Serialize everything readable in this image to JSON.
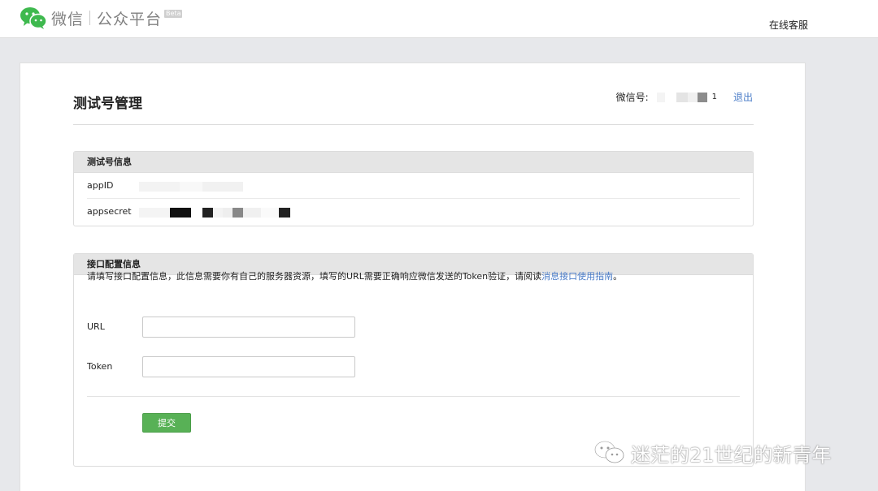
{
  "header": {
    "brand": "微信",
    "platform": "公众平台",
    "beta_badge": "Beta",
    "support_link": "在线客服"
  },
  "page": {
    "title": "测试号管理",
    "account_label": "微信号:",
    "account_tail": "1",
    "logout": "退出"
  },
  "test_account_panel": {
    "heading": "测试号信息",
    "rows": [
      {
        "label": "appID"
      },
      {
        "label": "appsecret"
      }
    ]
  },
  "interface_panel": {
    "heading": "接口配置信息",
    "intro_text": "请填写接口配置信息，此信息需要你有自己的服务器资源，填写的URL需要正确响应微信发送的Token验证，请阅读",
    "intro_link": "消息接口使用指南",
    "intro_end": "。",
    "url_label": "URL",
    "url_value": "",
    "token_label": "Token",
    "token_value": "",
    "submit_label": "提交"
  },
  "watermark": {
    "text": "迷茫的21世纪的新青年"
  },
  "colors": {
    "background": "#e7e8eb",
    "link": "#4a7cc8",
    "submit_button": "#58b156",
    "panel_header": "#e5e5e5",
    "brand_green": "#3eb94e"
  },
  "icons": {
    "logo": "wechat-logo-icon",
    "watermark": "wechat-watermark-icon"
  }
}
